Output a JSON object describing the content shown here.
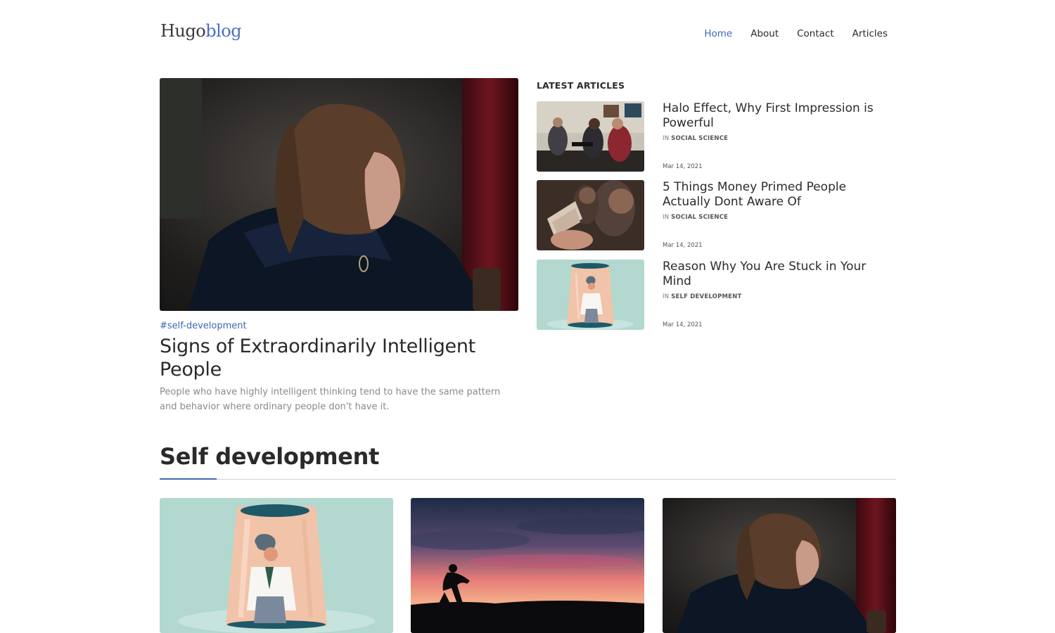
{
  "header": {
    "logo_part1": "Hugo",
    "logo_part2": "blog",
    "nav": [
      "Home",
      "About",
      "Contact",
      "Articles"
    ],
    "active_nav": "Home"
  },
  "hero": {
    "image": "woman-looking-down-photo",
    "tag": "#self-development",
    "title": "Signs of Extraordinarily Intelligent People",
    "description": "People who have highly intelligent thinking tend to have the same pattern and behavior where ordinary people don't have it."
  },
  "latest": {
    "heading": "LATEST ARTICLES",
    "items": [
      {
        "image": "group-sitting-photo",
        "title": "Halo Effect, Why First Impression is Powerful",
        "in": "IN",
        "category": "SOCIAL SCIENCE",
        "date": "Mar 14, 2021"
      },
      {
        "image": "money-hand-photo",
        "title": "5 Things Money Primed People Actually Dont Aware Of",
        "in": "IN",
        "category": "SOCIAL SCIENCE",
        "date": "Mar 14, 2021"
      },
      {
        "image": "person-in-glass-illustration",
        "title": "Reason Why You Are Stuck in Your Mind",
        "in": "IN",
        "category": "SELF DEVELOPMENT",
        "date": "Mar 14, 2021"
      }
    ]
  },
  "section": {
    "title": "Self development",
    "cards": [
      "person-in-glass-illustration",
      "sunset-kneeling-silhouette-photo",
      "woman-looking-down-photo"
    ]
  },
  "colors": {
    "accent": "#3f67b5",
    "text": "#2b2b2b",
    "muted": "#8a8a8a",
    "mint": "#b2d8cf",
    "peach": "#f1c3a8"
  }
}
